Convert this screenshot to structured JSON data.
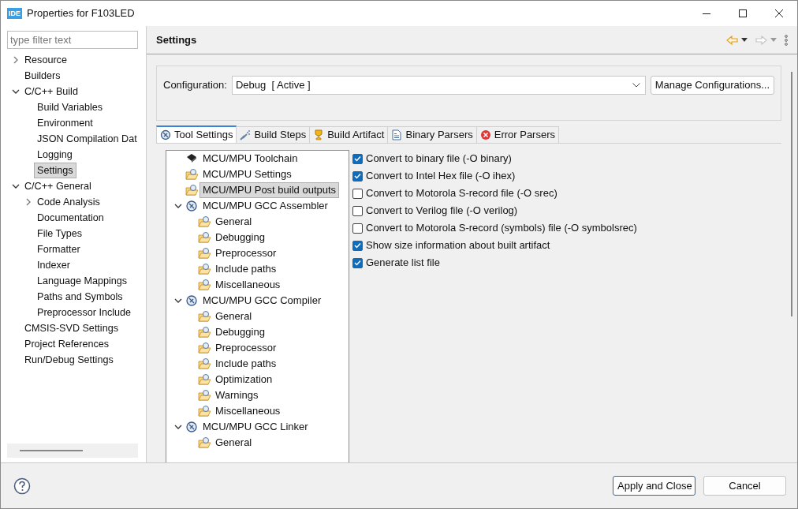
{
  "window": {
    "badge": "IDE",
    "title": "Properties for F103LED"
  },
  "filter": {
    "placeholder": "type filter text"
  },
  "nav_tree": [
    {
      "label": "Resource",
      "expanded": false,
      "selected": false
    },
    {
      "label": "Builders",
      "selected": false
    },
    {
      "label": "C/C++ Build",
      "expanded": true,
      "selected": false,
      "children": [
        {
          "label": "Build Variables",
          "selected": false
        },
        {
          "label": "Environment",
          "selected": false
        },
        {
          "label": "JSON Compilation Dat",
          "selected": false
        },
        {
          "label": "Logging",
          "selected": false
        },
        {
          "label": "Settings",
          "selected": true
        }
      ]
    },
    {
      "label": "C/C++ General",
      "expanded": true,
      "selected": false,
      "children": [
        {
          "label": "Code Analysis",
          "expanded": false,
          "selected": false
        },
        {
          "label": "Documentation",
          "selected": false
        },
        {
          "label": "File Types",
          "selected": false
        },
        {
          "label": "Formatter",
          "selected": false
        },
        {
          "label": "Indexer",
          "selected": false
        },
        {
          "label": "Language Mappings",
          "selected": false
        },
        {
          "label": "Paths and Symbols",
          "selected": false
        },
        {
          "label": "Preprocessor Include",
          "selected": false
        }
      ]
    },
    {
      "label": "CMSIS-SVD Settings",
      "selected": false
    },
    {
      "label": "Project References",
      "selected": false
    },
    {
      "label": "Run/Debug Settings",
      "selected": false
    }
  ],
  "page": {
    "title": "Settings",
    "back_disabled": false,
    "forward_disabled": true
  },
  "configuration": {
    "label": "Configuration:",
    "value": "Debug  [ Active ]",
    "manage_button": "Manage Configurations..."
  },
  "tabs": [
    {
      "label": "Tool Settings",
      "kind": "tool",
      "selected": true
    },
    {
      "label": "Build Steps",
      "kind": "steps",
      "selected": false
    },
    {
      "label": "Build Artifact",
      "kind": "artifact",
      "selected": false
    },
    {
      "label": "Binary Parsers",
      "kind": "binary",
      "selected": false
    },
    {
      "label": "Error Parsers",
      "kind": "error",
      "selected": false
    }
  ],
  "tool_tree": [
    {
      "label": "MCU/MPU Toolchain",
      "kind": "chip",
      "selected": false
    },
    {
      "label": "MCU/MPU Settings",
      "kind": "folder",
      "selected": false
    },
    {
      "label": "MCU/MPU Post build outputs",
      "kind": "folder",
      "selected": true
    },
    {
      "label": "MCU/MPU GCC Assembler",
      "kind": "tool",
      "expanded": true,
      "selected": false,
      "children": [
        {
          "label": "General",
          "kind": "folder",
          "selected": false
        },
        {
          "label": "Debugging",
          "kind": "folder",
          "selected": false
        },
        {
          "label": "Preprocessor",
          "kind": "folder",
          "selected": false
        },
        {
          "label": "Include paths",
          "kind": "folder",
          "selected": false
        },
        {
          "label": "Miscellaneous",
          "kind": "folder",
          "selected": false
        }
      ]
    },
    {
      "label": "MCU/MPU GCC Compiler",
      "kind": "tool",
      "expanded": true,
      "selected": false,
      "children": [
        {
          "label": "General",
          "kind": "folder",
          "selected": false
        },
        {
          "label": "Debugging",
          "kind": "folder",
          "selected": false
        },
        {
          "label": "Preprocessor",
          "kind": "folder",
          "selected": false
        },
        {
          "label": "Include paths",
          "kind": "folder",
          "selected": false
        },
        {
          "label": "Optimization",
          "kind": "folder",
          "selected": false
        },
        {
          "label": "Warnings",
          "kind": "folder",
          "selected": false
        },
        {
          "label": "Miscellaneous",
          "kind": "folder",
          "selected": false
        }
      ]
    },
    {
      "label": "MCU/MPU GCC Linker",
      "kind": "tool",
      "expanded": true,
      "selected": false,
      "children": [
        {
          "label": "General",
          "kind": "folder",
          "selected": false
        }
      ]
    }
  ],
  "options": [
    {
      "label": "Convert to binary file (-O binary)",
      "checked": true
    },
    {
      "label": "Convert to Intel Hex file (-O ihex)",
      "checked": true
    },
    {
      "label": "Convert to Motorola S-record file (-O srec)",
      "checked": false
    },
    {
      "label": "Convert to Verilog file (-O verilog)",
      "checked": false
    },
    {
      "label": "Convert to Motorola S-record (symbols) file (-O symbolsrec)",
      "checked": false
    },
    {
      "label": "Show size information about built artifact",
      "checked": true
    },
    {
      "label": "Generate list file",
      "checked": true
    }
  ],
  "buttons": [
    {
      "label": "Apply and Close",
      "default": true
    },
    {
      "label": "Cancel",
      "default": false
    }
  ]
}
